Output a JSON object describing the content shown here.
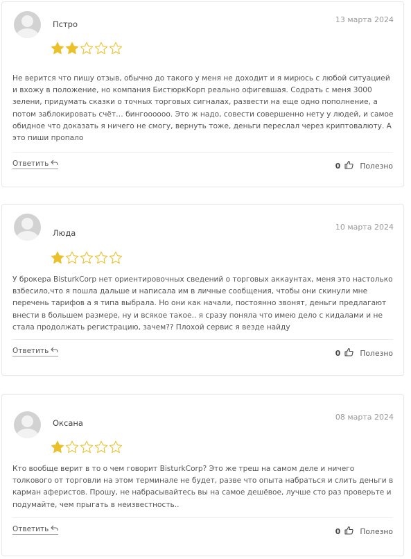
{
  "colors": {
    "star_filled": "#ebc12b",
    "star_empty_stroke": "#ebc12b",
    "avatar_bg": "#d2d2d2",
    "border": "#e9e9e9"
  },
  "reviews": [
    {
      "name": "Пстро",
      "date": "13 марта 2024",
      "rating": 2,
      "max_rating": 5,
      "text": "Не верится что пишу отзыв, обычно до такого у меня не доходит и я мирюсь с любой ситуацией и вхожу в положение, но компания БистюркКорп реально офигевшая. Содрать с меня 3000 зелени, придумать сказки о точных торговых сигналах, развести на еще одно пополнение, а потом заблокировать счёт… бингоооооо. Это ж надо, совести совершенно нету у людей, и самое обидное что доказать я ничего не смогу, вернуть тоже, деньги переслал через криптовалюту. А это пиши пропало",
      "reply_label": "Ответить",
      "likes": "0",
      "helpful_label": "Полезно"
    },
    {
      "name": "Люда",
      "date": "10 марта 2024",
      "rating": 1,
      "max_rating": 5,
      "text": "У брокера BisturkCorp нет ориентировочных сведений о торговых аккаунтах, меня это настолько взбесило,что я пошла дальше и написала им в личные сообщения, чтобы они скинули мне перечень тарифов а я типа выбрала. Но они как начали, постоянно звонят, деньги предлагают внести в большем размере, ну и всякое такое.. я сразу поняла что имею дело с кидалами и не стала продолжать регистрацию, зачем?? Плохой сервис я везде найду",
      "reply_label": "Ответить",
      "likes": "0",
      "helpful_label": "Полезно"
    },
    {
      "name": "Оксана",
      "date": "08 марта 2024",
      "rating": 1,
      "max_rating": 5,
      "text": "Кто вообще верит в то о чем говорит BisturkCorp? Это же треш на самом деле и ничего толкового от торговли на этом терминале не будет, разве что опыта набраться и слить деньги в карман аферистов. Прошу, не набрасывайтесь вы на самое дешёвое, лучше сто раз проверьте и подумайте, чем прыгать в неизвестность..",
      "reply_label": "Ответить",
      "likes": "0",
      "helpful_label": "Полезно"
    }
  ]
}
